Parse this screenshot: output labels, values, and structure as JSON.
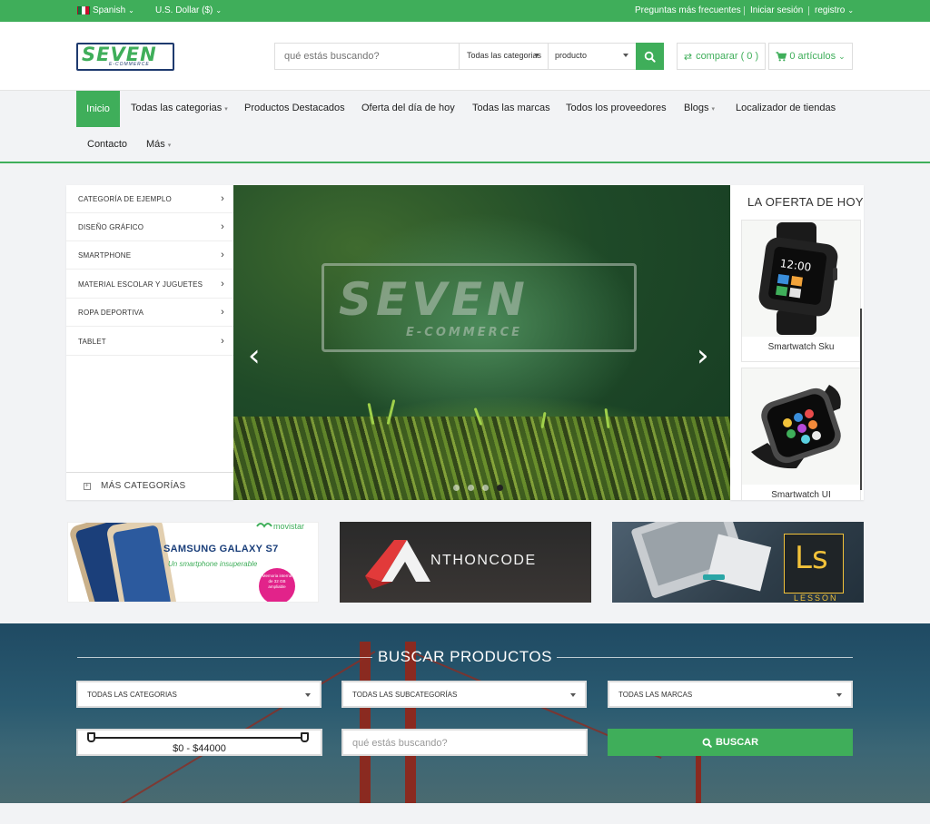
{
  "topbar": {
    "language": "Spanish",
    "currency": "U.S. Dollar ($)",
    "faq": "Preguntas más frecuentes",
    "login": "Iniciar sesión",
    "register": "registro"
  },
  "header": {
    "logo_text": "SEVEN",
    "logo_sub": "E-COMMERCE",
    "search_placeholder": "qué estás buscando?",
    "category_select": "Todas las categorias",
    "type_select": "producto",
    "compare": "comparar ( 0 )",
    "cart": "0 artículos"
  },
  "nav": {
    "items": [
      "Inicio",
      "Todas las categorias",
      "Productos Destacados",
      "Oferta del día de hoy",
      "Todas las marcas",
      "Todos los proveedores",
      "Blogs",
      "Localizador de tiendas",
      "Contacto",
      "Más"
    ]
  },
  "sidebar": {
    "categories": [
      "Categoría de ejemplo",
      "Diseño gráfico",
      "Smartphone",
      "Material escolar y juguetes",
      "Ropa deportiva",
      "Tablet"
    ],
    "more": "MÁS CATEGORÍAS"
  },
  "hero": {
    "logo_text": "SEVEN",
    "logo_sub": "E-COMMERCE",
    "slides": 4,
    "active_slide": 4
  },
  "deals": {
    "title": "LA OFERTA DE HOY",
    "products": [
      "Smartwatch Sku",
      "Smartwatch UI"
    ]
  },
  "banners": {
    "b1_brand": "movistar",
    "b1_title": "SAMSUNG GALAXY S7",
    "b1_sub": "Un smartphone insuperable",
    "b1_badge": "Memoria interna de 32 GB ampliable",
    "b2_letter": "A",
    "b2_text": "NTHONCODE",
    "b3_logo": "Ls",
    "b3_text": "LESSON"
  },
  "product_search": {
    "title": "BUSCAR PRODUCTOS",
    "categories": "TODAS LAS CATEGORIAS",
    "subcategories": "TODAS LAS SUBCATEGORÍAS",
    "brands": "TODAS LAS MARCAS",
    "price_range": "$0 - $44000",
    "input_placeholder": "qué estás buscando?",
    "button": "BUSCAR"
  },
  "colors": {
    "accent": "#3fae5a",
    "nav_bg": "#f2f3f5",
    "search_section": "#1f4a63"
  }
}
